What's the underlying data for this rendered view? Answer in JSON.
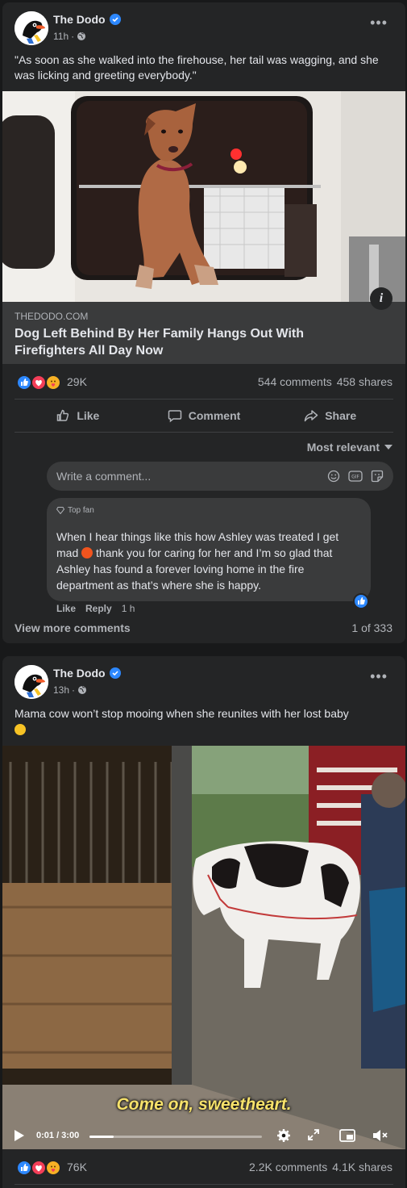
{
  "posts": [
    {
      "page_name": "The Dodo",
      "time": "11h",
      "separator": "·",
      "caption": "\"As soon as she walked into the firehouse, her tail was wagging, and she was licking and greeting everybody.\"",
      "link": {
        "domain": "THEDODO.COM",
        "headline": "Dog Left Behind By Her Family Hangs Out With Firefighters All Day Now",
        "info_label": "i"
      },
      "reactions_count": "29K",
      "comments": "544 comments",
      "shares": "458 shares",
      "actions": {
        "like": "Like",
        "comment": "Comment",
        "share": "Share"
      },
      "sort_label": "Most relevant",
      "comment_placeholder": "Write a comment...",
      "top_comment": {
        "badge": "Top fan",
        "text_before": "When I hear things like this how Ashley was treated I get mad",
        "text_after": "thank you for caring for her and I’m so glad that Ashley has found a forever loving home in the fire department as that’s where she is happy.",
        "like": "Like",
        "reply": "Reply",
        "time": "1 h"
      },
      "view_more": "View more comments",
      "pager": "1 of 333"
    },
    {
      "page_name": "The Dodo",
      "time": "13h",
      "separator": "·",
      "caption": "Mama cow won’t stop mooing when she reunites with her lost baby",
      "video": {
        "subtitle": "Come on, sweetheart.",
        "time": "0:01 / 3:00",
        "progress": 0.14
      },
      "reactions_count": "76K",
      "comments": "2.2K comments",
      "shares": "4.1K shares"
    }
  ],
  "colors": {
    "accent": "#2d88ff",
    "love": "#f33e58",
    "care": "#f7b125"
  }
}
